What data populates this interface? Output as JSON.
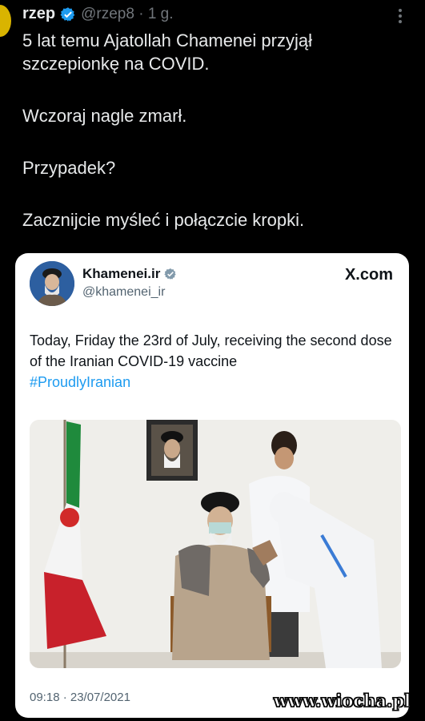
{
  "tweet": {
    "display_name": "rzep",
    "handle_meta": "@rzep8 · 1 g.",
    "paragraphs": [
      "5 lat temu Ajatollah Chamenei przyjął szczepionkę na COVID.",
      "Wczoraj nagle zmarł.",
      "Przypadek?",
      "Zacznijcie myśleć i połączcie kropki."
    ]
  },
  "quoted": {
    "display_name": "Khamenei.ir",
    "handle": "@khamenei_ir",
    "source": "X.com",
    "text": "Today, Friday the 23rd of July, receiving the second dose of the Iranian COVID-19 vaccine",
    "hashtag": "#ProudlyIranian",
    "timestamp": "09:18 · 23/07/2021"
  },
  "watermark": "www.wiocha.pl",
  "colors": {
    "background": "#000000",
    "verified": "#1d9bf0",
    "hashtag": "#1d9bf0"
  },
  "icons": [
    "verified-badge-icon",
    "more-icon"
  ]
}
